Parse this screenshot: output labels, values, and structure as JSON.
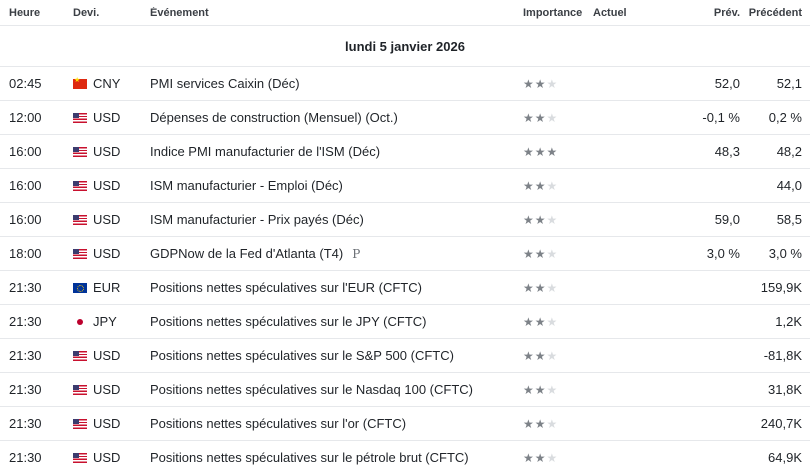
{
  "columns": {
    "time": "Heure",
    "currency": "Devi.",
    "event": "Événement",
    "importance": "Importance",
    "actual": "Actuel",
    "forecast": "Prév.",
    "previous": "Précédent"
  },
  "date_label": "lundi 5 janvier 2026",
  "rows": [
    {
      "time": "02:45",
      "flag": "cn",
      "flag_icon": "china-flag-icon",
      "currency": "CNY",
      "event": "PMI services Caixin  (Déc)",
      "importance": 2,
      "actual": "",
      "forecast": "52,0",
      "previous": "52,1"
    },
    {
      "time": "12:00",
      "flag": "us",
      "flag_icon": "us-flag-icon",
      "currency": "USD",
      "event": "Dépenses de construction (Mensuel) (Oct.)",
      "importance": 2,
      "actual": "",
      "forecast": "-0,1 %",
      "previous": "0,2 %"
    },
    {
      "time": "16:00",
      "flag": "us",
      "flag_icon": "us-flag-icon",
      "currency": "USD",
      "event": "Indice PMI manufacturier de l'ISM  (Déc)",
      "importance": 3,
      "actual": "",
      "forecast": "48,3",
      "previous": "48,2"
    },
    {
      "time": "16:00",
      "flag": "us",
      "flag_icon": "us-flag-icon",
      "currency": "USD",
      "event": "ISM manufacturier - Emploi  (Déc)",
      "importance": 2,
      "actual": "",
      "forecast": "",
      "previous": "44,0"
    },
    {
      "time": "16:00",
      "flag": "us",
      "flag_icon": "us-flag-icon",
      "currency": "USD",
      "event": "ISM manufacturier - Prix payés  (Déc)",
      "importance": 2,
      "actual": "",
      "forecast": "59,0",
      "previous": "58,5"
    },
    {
      "time": "18:00",
      "flag": "us",
      "flag_icon": "us-flag-icon",
      "currency": "USD",
      "event": "GDPNow de la Fed d'Atlanta  (T4)",
      "tag": "P",
      "importance": 2,
      "actual": "",
      "forecast": "3,0 %",
      "previous": "3,0 %"
    },
    {
      "time": "21:30",
      "flag": "eu",
      "flag_icon": "eu-flag-icon",
      "currency": "EUR",
      "event": "Positions nettes spéculatives sur l'EUR (CFTC)",
      "importance": 2,
      "actual": "",
      "forecast": "",
      "previous": "159,9K"
    },
    {
      "time": "21:30",
      "flag": "jp",
      "flag_icon": "japan-flag-icon",
      "currency": "JPY",
      "event": "Positions nettes spéculatives sur le JPY (CFTC)",
      "importance": 2,
      "actual": "",
      "forecast": "",
      "previous": "1,2K"
    },
    {
      "time": "21:30",
      "flag": "us",
      "flag_icon": "us-flag-icon",
      "currency": "USD",
      "event": "Positions nettes spéculatives sur le S&P 500 (CFTC)",
      "importance": 2,
      "actual": "",
      "forecast": "",
      "previous": "-81,8K"
    },
    {
      "time": "21:30",
      "flag": "us",
      "flag_icon": "us-flag-icon",
      "currency": "USD",
      "event": "Positions nettes spéculatives sur le Nasdaq 100 (CFTC)",
      "importance": 2,
      "actual": "",
      "forecast": "",
      "previous": "31,8K"
    },
    {
      "time": "21:30",
      "flag": "us",
      "flag_icon": "us-flag-icon",
      "currency": "USD",
      "event": "Positions nettes spéculatives sur l'or (CFTC)",
      "importance": 2,
      "actual": "",
      "forecast": "",
      "previous": "240,7K"
    },
    {
      "time": "21:30",
      "flag": "us",
      "flag_icon": "us-flag-icon",
      "currency": "USD",
      "event": "Positions nettes spéculatives sur le pétrole brut (CFTC)",
      "importance": 2,
      "actual": "",
      "forecast": "",
      "previous": "64,9K"
    }
  ],
  "colors": {
    "star_active": "#7d8288",
    "star_inactive": "#d9dcdf",
    "divider": "#e6e8eb"
  }
}
